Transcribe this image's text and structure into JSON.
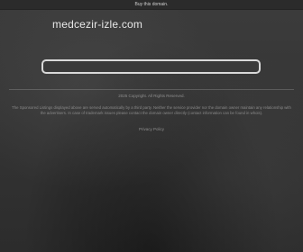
{
  "topbar": {
    "buy_link": "Buy this domain."
  },
  "domain": {
    "title": "medcezir-izle.com"
  },
  "search": {
    "value": "",
    "placeholder": ""
  },
  "footer": {
    "copyright": "2025 Copyright. All Rights Reserved.",
    "disclaimer": "The Sponsored Listings displayed above are served automatically by a third party. Neither the service provider nor the domain owner maintain any relationship with the advertisers. In case of trademark issues please contact the domain owner directly (contact information can be found in whois).",
    "privacy_link": "Privacy Policy"
  },
  "colors": {
    "background": "#3a3a3a",
    "title_text": "#e8e8e8",
    "search_border": "#d9d9d9",
    "footer_text": "#8f8f8f"
  }
}
